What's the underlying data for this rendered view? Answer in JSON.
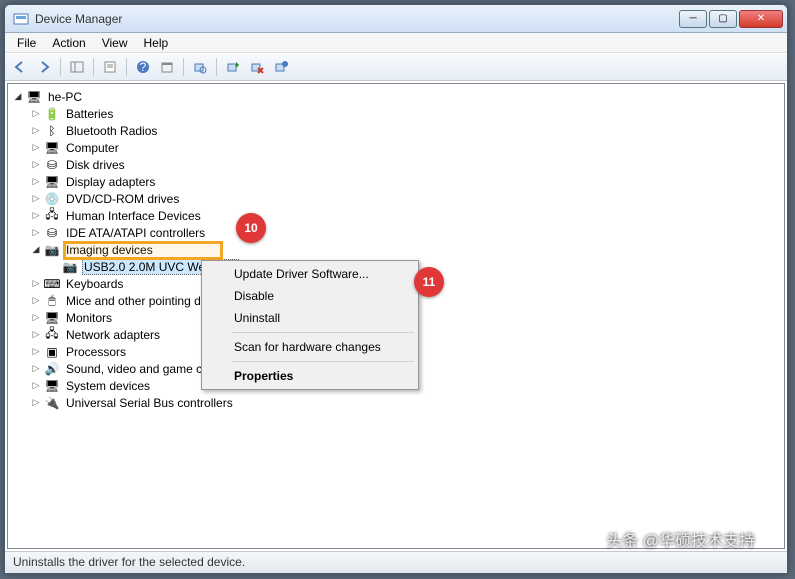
{
  "window": {
    "title": "Device Manager"
  },
  "menu": {
    "file": "File",
    "action": "Action",
    "view": "View",
    "help": "Help"
  },
  "tree": {
    "root": "he-PC",
    "items": [
      {
        "label": "Batteries",
        "icon": "🔋"
      },
      {
        "label": "Bluetooth Radios",
        "icon": "ᛒ"
      },
      {
        "label": "Computer",
        "icon": "🖥"
      },
      {
        "label": "Disk drives",
        "icon": "⛁"
      },
      {
        "label": "Display adapters",
        "icon": "🖥"
      },
      {
        "label": "DVD/CD-ROM drives",
        "icon": "💿"
      },
      {
        "label": "Human Interface Devices",
        "icon": "🖧"
      },
      {
        "label": "IDE ATA/ATAPI controllers",
        "icon": "⛁"
      },
      {
        "label": "Imaging devices",
        "icon": "📷",
        "expanded": true,
        "children": [
          {
            "label": "USB2.0 2.0M UVC WebCam",
            "icon": "📷",
            "selected": true
          }
        ]
      },
      {
        "label": "Keyboards",
        "icon": "⌨"
      },
      {
        "label": "Mice and other pointing devices",
        "icon": "🖱"
      },
      {
        "label": "Monitors",
        "icon": "🖥"
      },
      {
        "label": "Network adapters",
        "icon": "🖧"
      },
      {
        "label": "Processors",
        "icon": "▣"
      },
      {
        "label": "Sound, video and game controllers",
        "icon": "🔊"
      },
      {
        "label": "System devices",
        "icon": "🖥"
      },
      {
        "label": "Universal Serial Bus controllers",
        "icon": "🔌"
      }
    ]
  },
  "context_menu": {
    "update": "Update Driver Software...",
    "disable": "Disable",
    "uninstall": "Uninstall",
    "scan": "Scan for hardware changes",
    "properties": "Properties"
  },
  "callouts": {
    "c10": "10",
    "c11": "11"
  },
  "status": "Uninstalls the driver for the selected device.",
  "watermark": "头条 @华硕技术支持"
}
